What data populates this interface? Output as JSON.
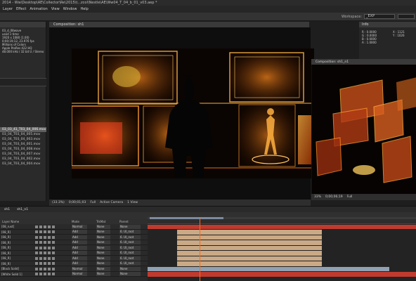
{
  "app": {
    "title": "2014 - Ww\\Desktop\\AE\\Collector\\Re\\2015\\t...zcol\\Nestle\\AE\\Ww04_T_04_b_01_v03.aep *"
  },
  "menu": [
    "Layer",
    "Effect",
    "Animation",
    "View",
    "Window",
    "Help"
  ],
  "workspace": {
    "label": "Workspace:",
    "value": "_EXP"
  },
  "project": {
    "selected_item": "03_d_08wave",
    "info": [
      "used 1 time",
      "1920 x 1080 (1.00)",
      "0;00;19;12, 23.976 fps",
      "Millions of Colors",
      "Apple ProRes 422 HQ",
      "48.000 kHz / 32 bit U / Stereo"
    ],
    "items": [
      {
        "name": "03_03_41_T03_04_006.mov",
        "selected": true
      },
      {
        "name": "03_04_T03_04_005.mov",
        "selected": false
      },
      {
        "name": "03_04_T03_04_003.mov",
        "selected": false
      },
      {
        "name": "03_04_T03_04_001.mov",
        "selected": false
      },
      {
        "name": "03_04_T03_04_008.mov",
        "selected": false
      },
      {
        "name": "03_04_T03_04_007.mov",
        "selected": false
      },
      {
        "name": "03_04_T03_04_002.mov",
        "selected": false
      },
      {
        "name": "03_04_T03_04_004.mov",
        "selected": false
      }
    ]
  },
  "composition": {
    "tab_label": "Composition: sh1",
    "controls": [
      "(33.3%)",
      "0;00;01;03",
      "Full",
      "Active Camera",
      "1 View"
    ]
  },
  "info_panel": {
    "title": "Info",
    "left": [
      "R : 0.0000",
      "G : 0.0000",
      "B : 0.0000",
      "A : 1.0000"
    ],
    "right": [
      "X : 1121",
      "Y : 1026",
      "",
      ""
    ]
  },
  "float_comp": {
    "tab_label": "Composition: sh1_n1",
    "controls": [
      "33%",
      "0;00;06;19",
      "Full"
    ]
  },
  "timeline": {
    "tabs": [
      "sh1",
      "sh1_n1"
    ],
    "headers": [
      "Layer Name",
      "Mode",
      "TrkMat",
      "Parent"
    ],
    "layers": [
      {
        "name": "[08_rust]",
        "mode": "Normal",
        "trk": "None",
        "parent": "None",
        "color": "#c03a2e",
        "start": 0.0,
        "end": 1.0
      },
      {
        "name": "[08_R]",
        "mode": "Add",
        "trk": "None",
        "parent": "6. UI_root",
        "color": "#c9a986",
        "start": 0.11,
        "end": 0.65
      },
      {
        "name": "[08_R]",
        "mode": "Add",
        "trk": "None",
        "parent": "6. UI_root",
        "color": "#c9a986",
        "start": 0.11,
        "end": 0.65
      },
      {
        "name": "[08_R]",
        "mode": "Add",
        "trk": "None",
        "parent": "6. UI_root",
        "color": "#c9a986",
        "start": 0.11,
        "end": 0.65
      },
      {
        "name": "[08_R]",
        "mode": "Add",
        "trk": "None",
        "parent": "6. UI_root",
        "color": "#c9a986",
        "start": 0.11,
        "end": 0.65
      },
      {
        "name": "[08_R]",
        "mode": "Add",
        "trk": "None",
        "parent": "6. UI_root",
        "color": "#c9a986",
        "start": 0.11,
        "end": 0.65
      },
      {
        "name": "[08_R]",
        "mode": "Add",
        "trk": "None",
        "parent": "6. UI_root",
        "color": "#c9a986",
        "start": 0.11,
        "end": 0.65
      },
      {
        "name": "[08_R]",
        "mode": "Add",
        "trk": "None",
        "parent": "6. UI_root",
        "color": "#c9a986",
        "start": 0.11,
        "end": 0.65
      },
      {
        "name": "[Black Solid]",
        "mode": "Normal",
        "trk": "None",
        "parent": "None",
        "color": "#8fa1b3",
        "start": 0.0,
        "end": 0.9
      },
      {
        "name": "[White Solid 1]",
        "mode": "Normal",
        "trk": "None",
        "parent": "None",
        "color": "#c03a2e",
        "start": 0.0,
        "end": 1.0
      }
    ]
  }
}
